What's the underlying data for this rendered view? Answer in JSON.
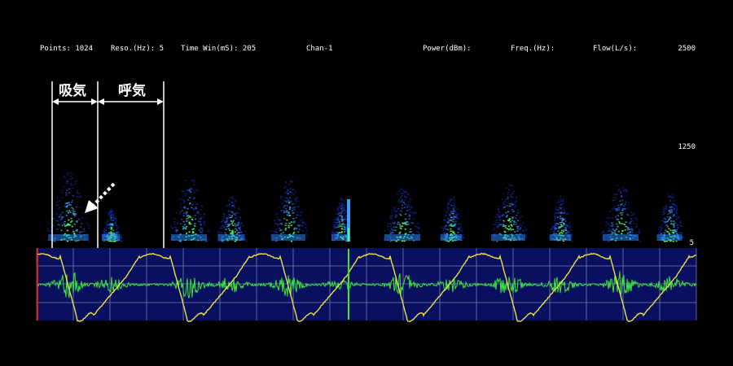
{
  "status": {
    "points": "Points: 1024",
    "resolution": "Reso.(Hz):  5",
    "time_window": "Time Win(mS): 205",
    "channel": "Chan-1",
    "power": "Power(dBm):",
    "frequency": "Freq.(Hz):",
    "flow": "Flow(L/s):"
  },
  "spectrogram": {
    "y_max": "2500",
    "y_mid": "1250",
    "y_min": "5"
  },
  "annotations": {
    "inspiration": "吸気",
    "expiration": "呼気"
  },
  "colors": {
    "background": "#000000",
    "spectrogram_low": "#0a1a8a",
    "spectrogram_mid": "#3a7cff",
    "spectrogram_high": "#4dff6a",
    "waveform_panel": "#0a1060",
    "sound_wave": "#39e639",
    "flow_curve": "#e8e040",
    "grid": "#8f96b8"
  },
  "icons": {
    "arrow": "dashed-arrow-icon"
  }
}
